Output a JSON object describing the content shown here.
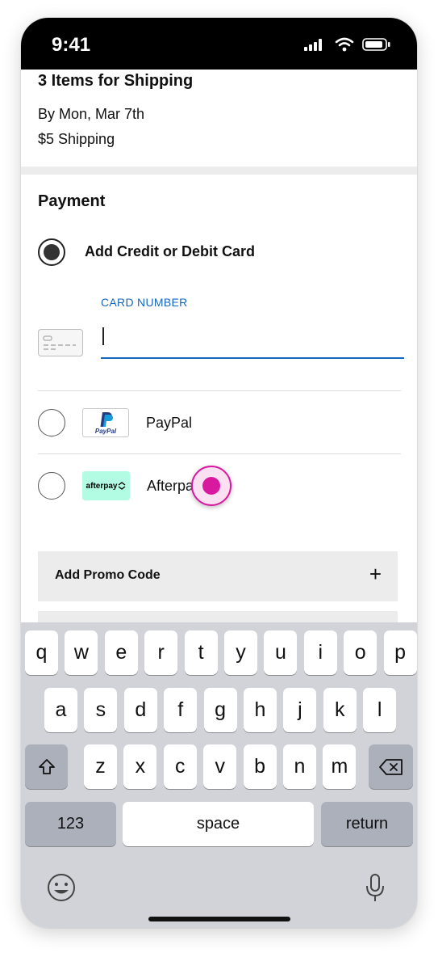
{
  "status": {
    "time": "9:41"
  },
  "shipping": {
    "title": "3 Items for Shipping",
    "date": "By Mon, Mar 7th",
    "cost": "$5 Shipping"
  },
  "payment": {
    "title": "Payment",
    "options": [
      {
        "label": "Add Credit or Debit Card",
        "selected": true
      },
      {
        "label": "PayPal",
        "selected": false,
        "logo_text": "PayPal"
      },
      {
        "label": "Afterpay",
        "selected": false,
        "logo_text": "afterpay"
      }
    ],
    "card_number_label": "CARD NUMBER",
    "card_number_value": ""
  },
  "promo": {
    "label": "Add Promo Code",
    "icon": "plus-icon"
  },
  "keyboard": {
    "row1": [
      "q",
      "w",
      "e",
      "r",
      "t",
      "y",
      "u",
      "i",
      "o",
      "p"
    ],
    "row2": [
      "a",
      "s",
      "d",
      "f",
      "g",
      "h",
      "j",
      "k",
      "l"
    ],
    "row3": [
      "z",
      "x",
      "c",
      "v",
      "b",
      "n",
      "m"
    ],
    "numbers_label": "123",
    "space_label": "space",
    "return_label": "return"
  },
  "colors": {
    "accent": "#1566c0",
    "touch_indicator": "#d8199f",
    "afterpay_mint": "#b2fce4"
  }
}
